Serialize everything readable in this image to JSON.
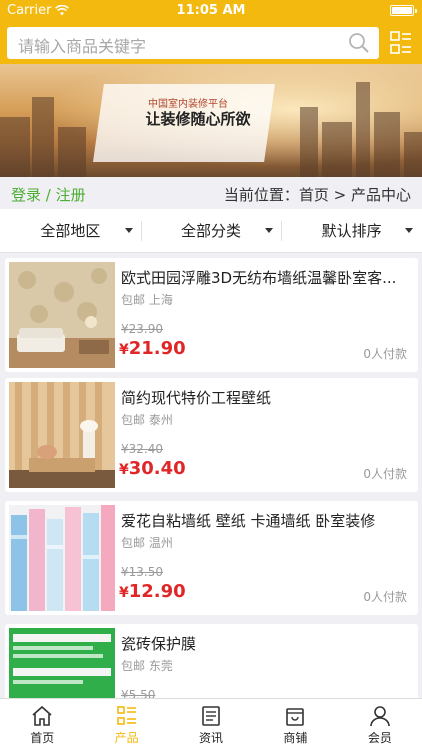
{
  "status": {
    "carrier": "Carrier",
    "time": "11:05 AM"
  },
  "search": {
    "placeholder": "请输入商品关键字"
  },
  "banner": {
    "subtitle": "中国室内装修平台",
    "slogan": "让装修随心所欲"
  },
  "location": {
    "login": "登录 / 注册",
    "breadcrumb": "当前位置：首页 > 产品中心"
  },
  "filters": [
    {
      "label": "全部地区"
    },
    {
      "label": "全部分类"
    },
    {
      "label": "默认排序"
    }
  ],
  "products": [
    {
      "title": "欧式田园浮雕3D无纺布墙纸温馨卧室客...",
      "shipping": "包邮 上海",
      "original_price": "¥23.90",
      "currency": "¥",
      "price": "21.90",
      "sold": "0人付款"
    },
    {
      "title": "简约现代特价工程壁纸",
      "shipping": "包邮 泰州",
      "original_price": "¥32.40",
      "currency": "¥",
      "price": "30.40",
      "sold": "0人付款"
    },
    {
      "title": "爱花自粘墙纸 壁纸 卡通墙纸 卧室装修",
      "shipping": "包邮 温州",
      "original_price": "¥13.50",
      "currency": "¥",
      "price": "12.90",
      "sold": "0人付款"
    },
    {
      "title": "瓷砖保护膜",
      "shipping": "包邮 东莞",
      "original_price": "¥5.50",
      "currency": "¥",
      "price": "",
      "sold": ""
    }
  ],
  "tabs": [
    {
      "label": "首页",
      "icon": "home-icon"
    },
    {
      "label": "产品",
      "icon": "list-icon",
      "active": true
    },
    {
      "label": "资讯",
      "icon": "news-icon"
    },
    {
      "label": "商铺",
      "icon": "shop-icon"
    },
    {
      "label": "会员",
      "icon": "user-icon"
    }
  ],
  "colors": {
    "accent": "#f4b90f",
    "login": "#4cae33",
    "price": "#e02626"
  }
}
